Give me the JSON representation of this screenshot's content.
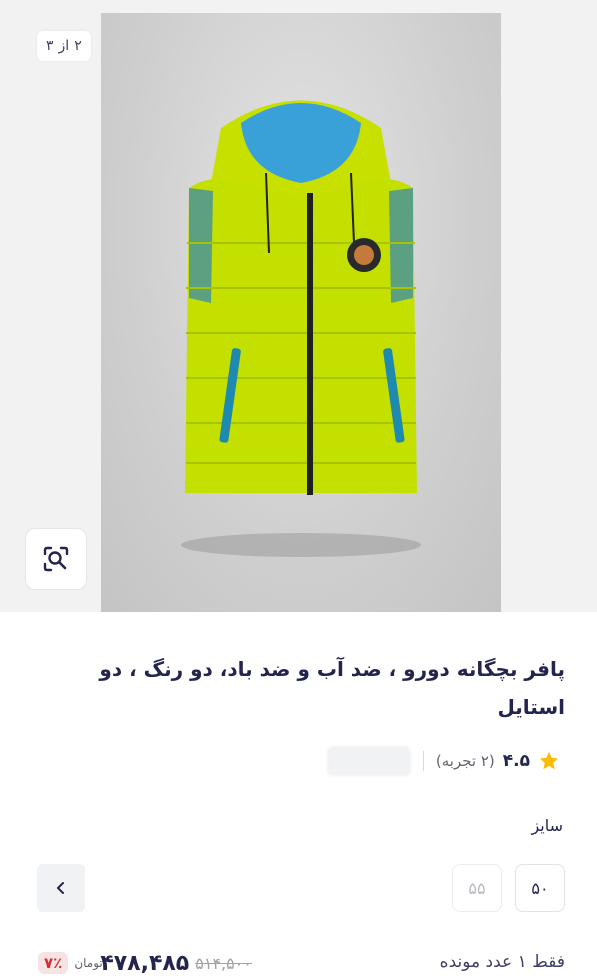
{
  "gallery": {
    "counter": {
      "current": "۲",
      "of": "از",
      "total": "۳"
    },
    "image_alt": "vest-product-photo"
  },
  "product": {
    "title": "پافر بچگانه دورو ، ضد آب و ضد باد، دو رنگ ، دو استایل",
    "rating": "۴.۵",
    "rating_count": "(۲ تجربه)"
  },
  "sizes": {
    "label": "سایز",
    "options": [
      "۵۰",
      "۵۵"
    ]
  },
  "purchase": {
    "stock": "فقط ۱ عدد مونده",
    "discount": "۷٪",
    "currency": "تومان",
    "price": "۴۷۸,۴۸۵",
    "old_price": "۵۱۴,۵۰۰"
  },
  "colors": {
    "accent": "#d32f2f",
    "star": "#f9bc00",
    "text": "#23254e"
  }
}
